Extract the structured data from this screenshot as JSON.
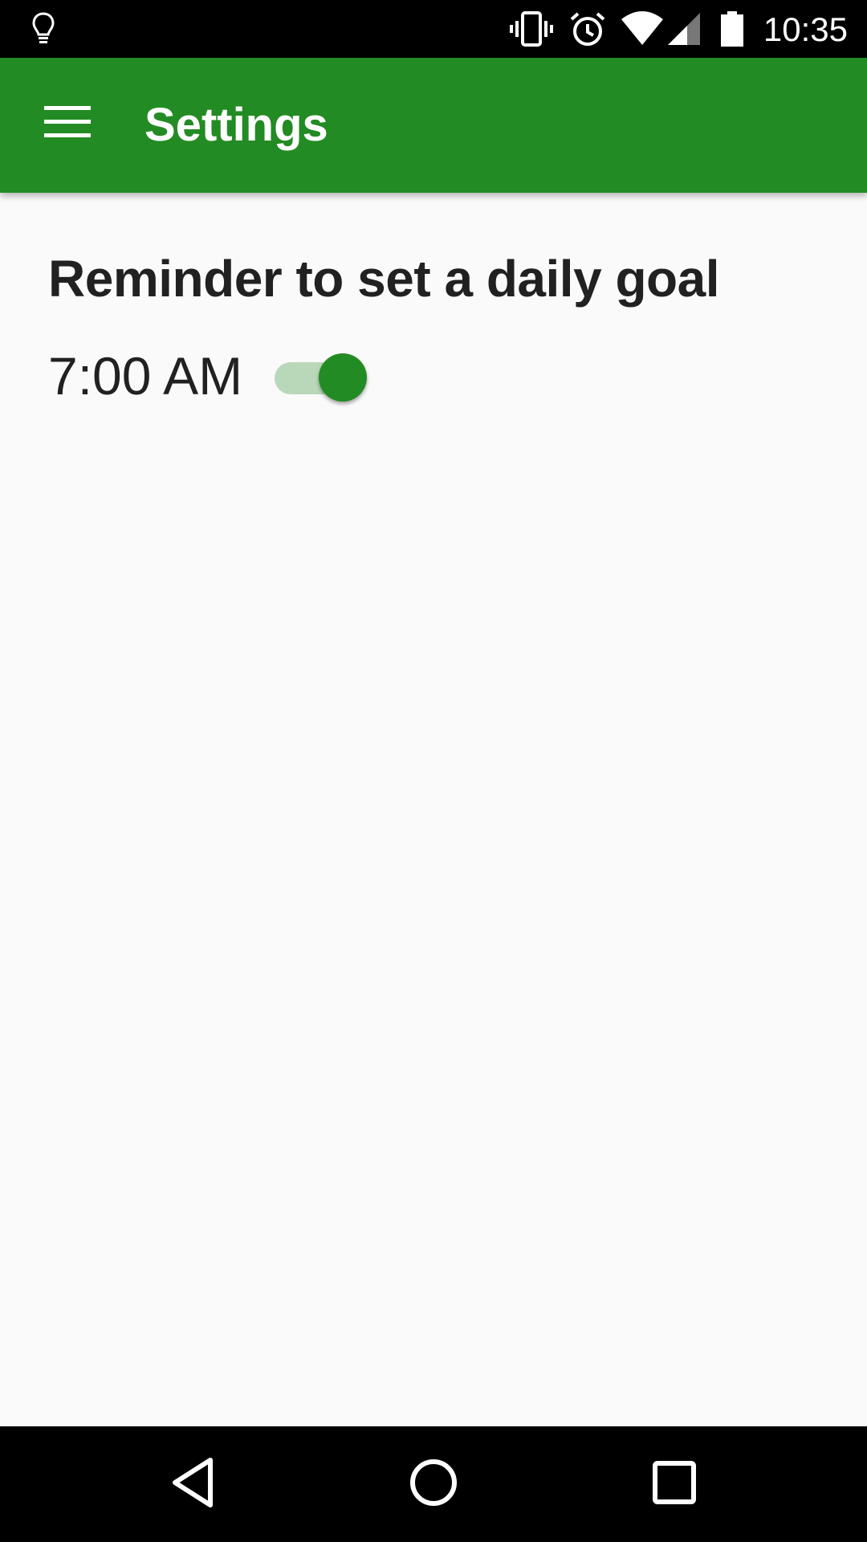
{
  "status_bar": {
    "time": "10:35",
    "icons": [
      "lightbulb-icon",
      "vibrate-icon",
      "alarm-icon",
      "wifi-icon",
      "signal-icon",
      "battery-icon"
    ]
  },
  "app_bar": {
    "title": "Settings",
    "menu_icon": "hamburger-menu-icon",
    "background_color": "#238b23"
  },
  "settings": {
    "reminder_title": "Reminder to set a daily goal",
    "reminder_time": "7:00 AM",
    "reminder_enabled": true,
    "switch_track_color": "#b9d8b9",
    "switch_thumb_color": "#238b23"
  },
  "nav_bar": {
    "icons": [
      "back-icon",
      "home-icon",
      "recents-icon"
    ]
  }
}
